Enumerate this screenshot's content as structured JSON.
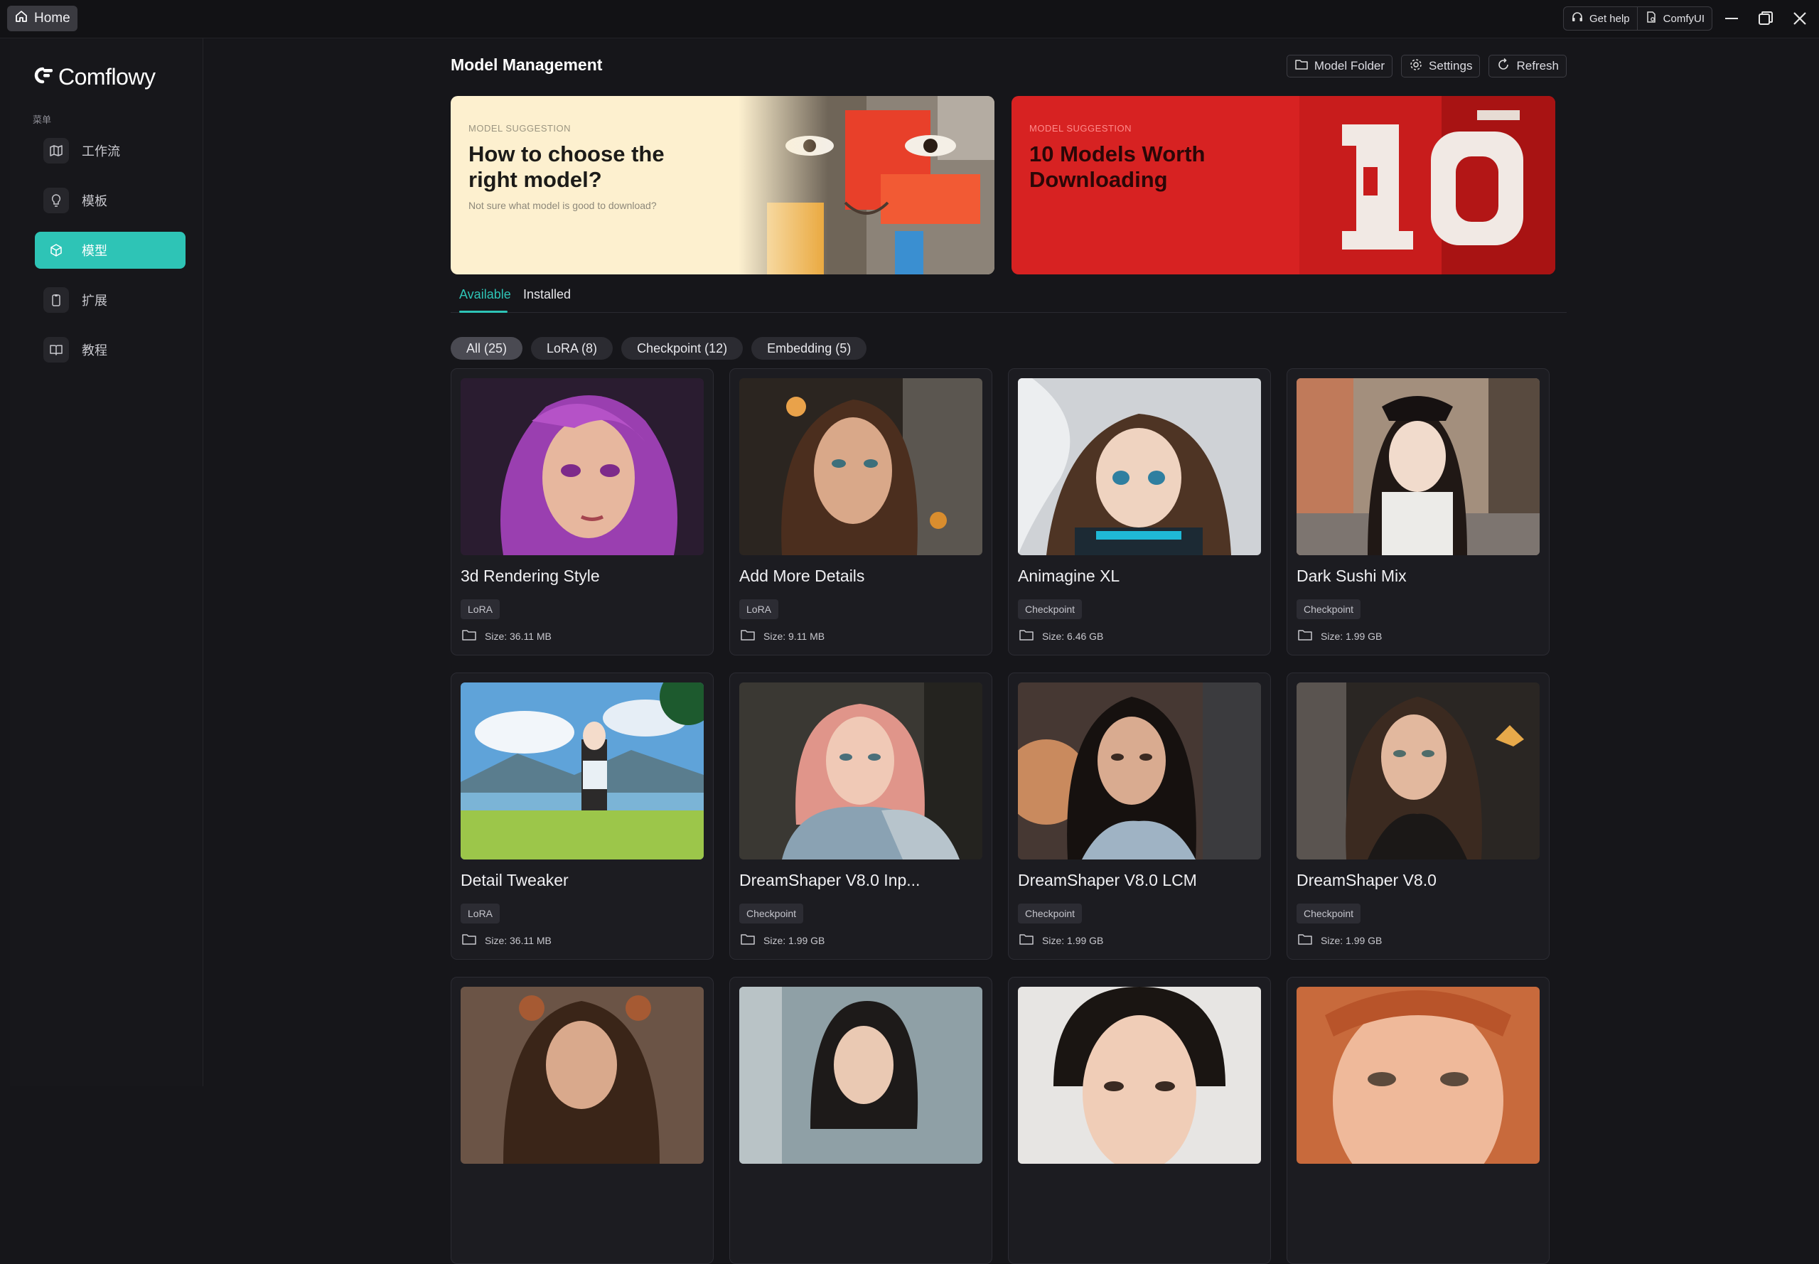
{
  "titlebar": {
    "home_label": "Home",
    "get_help_label": "Get help",
    "comfyui_label": "ComfyUI"
  },
  "sidebar": {
    "brand": "Comflowy",
    "menu_label": "菜单",
    "items": [
      {
        "label": "工作流",
        "icon": "map-icon"
      },
      {
        "label": "模板",
        "icon": "lightbulb-icon"
      },
      {
        "label": "模型",
        "icon": "cube-icon"
      },
      {
        "label": "扩展",
        "icon": "clipboard-icon"
      },
      {
        "label": "教程",
        "icon": "book-icon"
      }
    ],
    "active_index": 2
  },
  "main": {
    "title": "Model Management",
    "actions": {
      "model_folder": "Model Folder",
      "settings": "Settings",
      "refresh": "Refresh"
    },
    "banners": [
      {
        "kicker": "MODEL SUGGESTION",
        "title": "How to choose the right model?",
        "subtitle": "Not sure what model is good to download?"
      },
      {
        "kicker": "MODEL SUGGESTION",
        "title": "10 Models Worth Downloading"
      }
    ],
    "tabs": [
      "Available",
      "Installed"
    ],
    "active_tab": 0,
    "filters": [
      "All (25)",
      "LoRA (8)",
      "Checkpoint (12)",
      "Embedding (5)"
    ],
    "active_filter": 0,
    "models": [
      {
        "name": "3d Rendering Style",
        "type": "LoRA",
        "size": "Size: 36.11 MB"
      },
      {
        "name": "Add More Details",
        "type": "LoRA",
        "size": "Size: 9.11 MB"
      },
      {
        "name": "Animagine XL",
        "type": "Checkpoint",
        "size": "Size: 6.46 GB"
      },
      {
        "name": "Dark Sushi Mix",
        "type": "Checkpoint",
        "size": "Size: 1.99 GB"
      },
      {
        "name": "Detail Tweaker",
        "type": "LoRA",
        "size": "Size: 36.11 MB"
      },
      {
        "name": "DreamShaper V8.0 Inp...",
        "type": "Checkpoint",
        "size": "Size: 1.99 GB"
      },
      {
        "name": "DreamShaper V8.0 LCM",
        "type": "Checkpoint",
        "size": "Size: 1.99 GB"
      },
      {
        "name": "DreamShaper V8.0",
        "type": "Checkpoint",
        "size": "Size: 1.99 GB"
      }
    ]
  },
  "colors": {
    "accent": "#2ec4b6",
    "background": "#16161a",
    "banner_cream": "#fdf0cf",
    "banner_red": "#d72222"
  }
}
